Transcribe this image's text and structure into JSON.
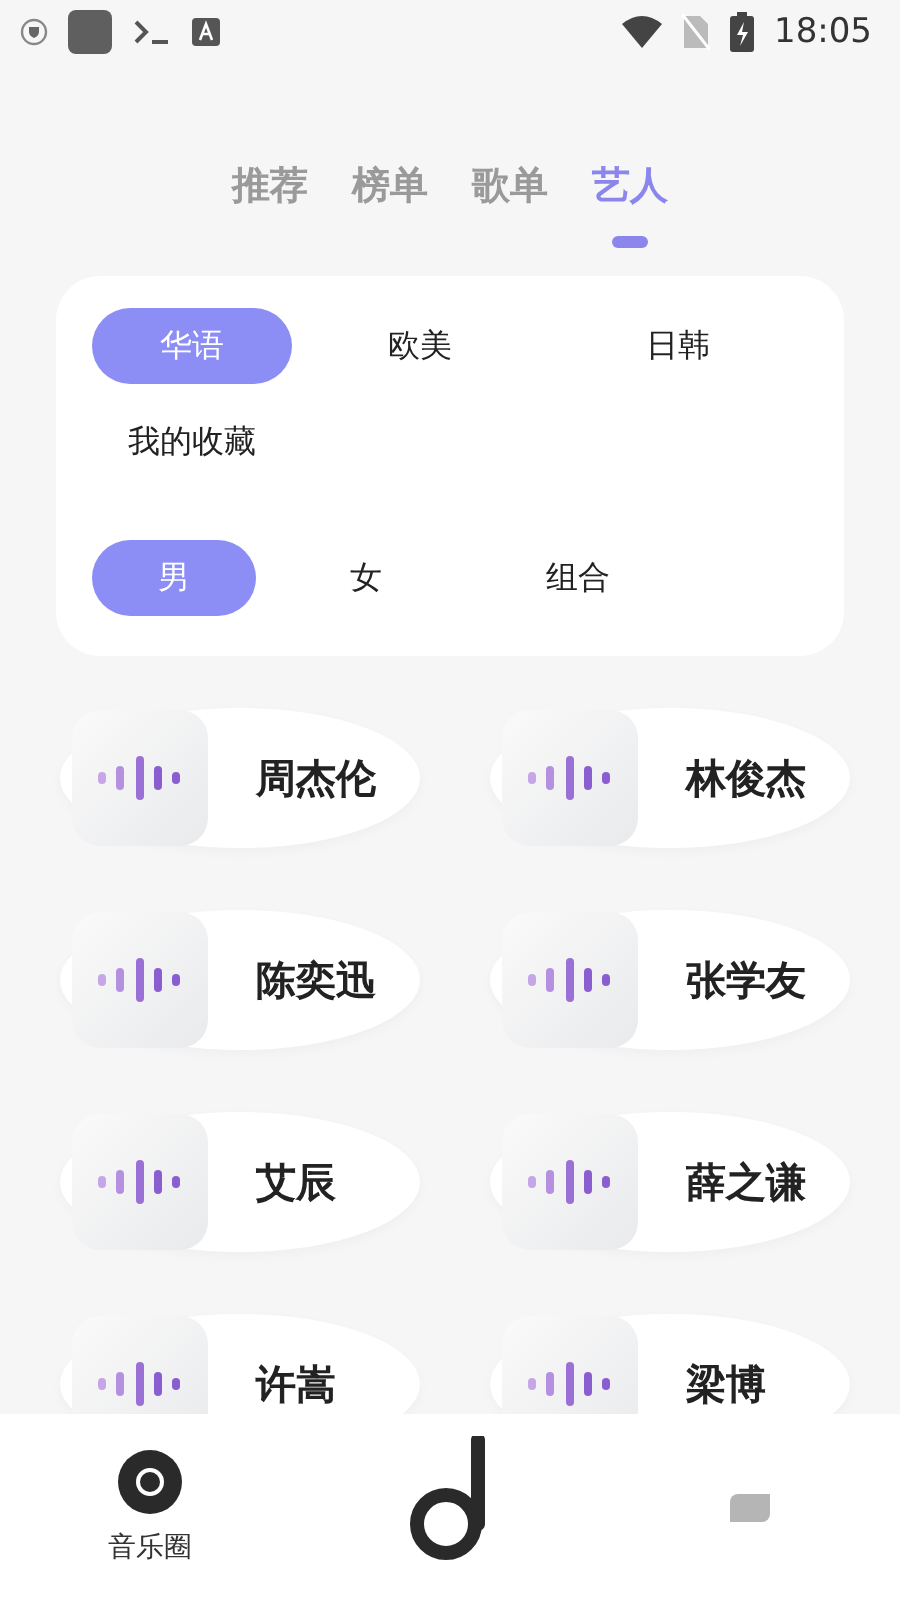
{
  "status_bar": {
    "time": "18:05"
  },
  "tabs": [
    {
      "label": "推荐",
      "selected": false
    },
    {
      "label": "榜单",
      "selected": false
    },
    {
      "label": "歌单",
      "selected": false
    },
    {
      "label": "艺人",
      "selected": true
    }
  ],
  "filters": {
    "region": [
      {
        "label": "华语",
        "selected": true
      },
      {
        "label": "欧美",
        "selected": false
      },
      {
        "label": "日韩",
        "selected": false
      },
      {
        "label": "我的收藏",
        "selected": false
      }
    ],
    "gender": [
      {
        "label": "男",
        "selected": true
      },
      {
        "label": "女",
        "selected": false
      },
      {
        "label": "组合",
        "selected": false
      }
    ]
  },
  "artists": [
    {
      "name": "周杰伦"
    },
    {
      "name": "林俊杰"
    },
    {
      "name": "陈奕迅"
    },
    {
      "name": "张学友"
    },
    {
      "name": "艾辰"
    },
    {
      "name": "薛之谦"
    },
    {
      "name": "许嵩"
    },
    {
      "name": "梁博"
    }
  ],
  "bottom_nav": [
    {
      "kind": "disc",
      "label": "音乐圈"
    },
    {
      "kind": "logo"
    },
    {
      "kind": "bubble"
    }
  ]
}
